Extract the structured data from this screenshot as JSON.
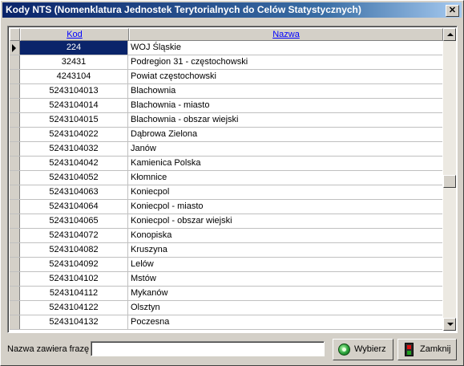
{
  "window": {
    "title": "Kody NTS (Nomenklatura Jednostek Terytorialnych do Celów Statystycznych)",
    "close_glyph": "✕"
  },
  "table": {
    "columns": {
      "kod": "Kod",
      "nazwa": "Nazwa"
    },
    "selected_row": 0,
    "rows": [
      {
        "kod": "224",
        "nazwa": "WOJ Śląskie"
      },
      {
        "kod": "32431",
        "nazwa": "Podregion 31 - częstochowski"
      },
      {
        "kod": "4243104",
        "nazwa": "Powiat częstochowski"
      },
      {
        "kod": "5243104013",
        "nazwa": "Blachownia"
      },
      {
        "kod": "5243104014",
        "nazwa": "Blachownia - miasto"
      },
      {
        "kod": "5243104015",
        "nazwa": "Blachownia - obszar wiejski"
      },
      {
        "kod": "5243104022",
        "nazwa": "Dąbrowa Zielona"
      },
      {
        "kod": "5243104032",
        "nazwa": "Janów"
      },
      {
        "kod": "5243104042",
        "nazwa": "Kamienica Polska"
      },
      {
        "kod": "5243104052",
        "nazwa": "Kłomnice"
      },
      {
        "kod": "5243104063",
        "nazwa": "Koniecpol"
      },
      {
        "kod": "5243104064",
        "nazwa": "Koniecpol - miasto"
      },
      {
        "kod": "5243104065",
        "nazwa": "Koniecpol - obszar wiejski"
      },
      {
        "kod": "5243104072",
        "nazwa": "Konopiska"
      },
      {
        "kod": "5243104082",
        "nazwa": "Kruszyna"
      },
      {
        "kod": "5243104092",
        "nazwa": "Lelów"
      },
      {
        "kod": "5243104102",
        "nazwa": "Mstów"
      },
      {
        "kod": "5243104112",
        "nazwa": "Mykanów"
      },
      {
        "kod": "5243104122",
        "nazwa": "Olsztyn"
      },
      {
        "kod": "5243104132",
        "nazwa": "Poczesna"
      }
    ]
  },
  "footer": {
    "filter_label": "Nazwa zawiera frazę",
    "filter_value": "",
    "select_button": "Wybierz",
    "close_button": "Zamknij"
  },
  "icons": {
    "select_button_icon": "green-circle-icon",
    "close_button_icon": "traffic-light-exit-icon"
  },
  "colors": {
    "title_gradient_start": "#0a246a",
    "selection": "#0a246a",
    "header_link": "#0000ff"
  }
}
